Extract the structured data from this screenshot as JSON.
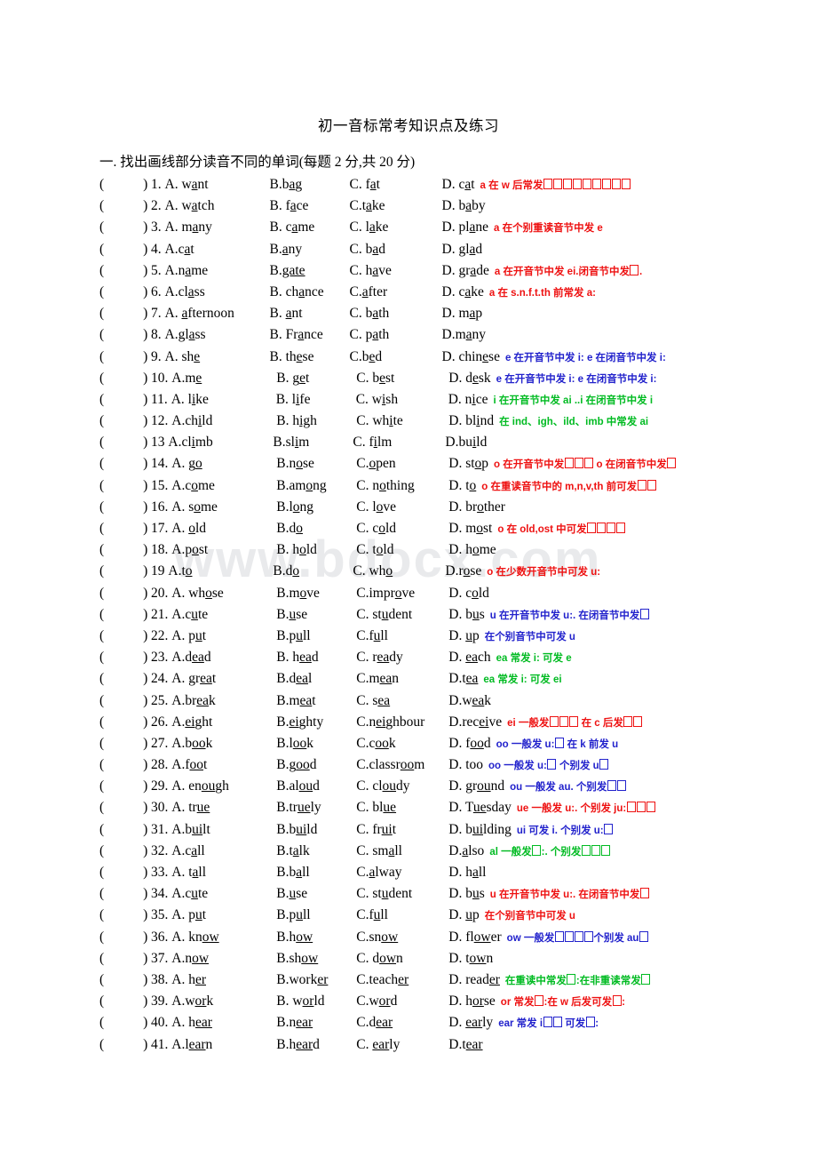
{
  "document": {
    "title": "初一音标常考知识点及练习",
    "watermark": "www.bdocx.com",
    "section_heading": "一. 找出画线部分读音不同的单词(每题 2 分,共 20 分)",
    "paren_open": "(",
    "paren_close": ")"
  },
  "colors": {
    "red": "#ee1111",
    "blue": "#2222cc",
    "green": "#00bb22",
    "text": "#000000",
    "watermark": "#e9eaec"
  },
  "questions": [
    {
      "num": "1.",
      "a": "A. w<u>a</u>nt",
      "b": "B.b<u>a</u>g",
      "c": "C. f<u>a</u>t",
      "d": "D. c<u>a</u>t",
      "note": "a 在 w 后常发▯▯▯▯▯▯▯▯▯",
      "note_color": "red"
    },
    {
      "num": "2.",
      "a": "A. w<u>a</u>tch",
      "b": "B. f<u>a</u>ce",
      "c": "C.t<u>a</u>ke",
      "d": "D. b<u>a</u>by",
      "note": "",
      "note_color": "red"
    },
    {
      "num": "3.",
      "a": "A. m<u>a</u>ny",
      "b": "B. c<u>a</u>me",
      "c": "C. l<u>a</u>ke",
      "d": "D. pl<u>a</u>ne",
      "note": "a 在个别重读音节中发 e",
      "note_color": "red"
    },
    {
      "num": "4.",
      "a": "A.c<u>a</u>t",
      "b": "B.<u>a</u>ny",
      "c": "C. b<u>a</u>d",
      "d": "D. gl<u>a</u>d",
      "note": "",
      "note_color": "red"
    },
    {
      "num": "5.",
      "a": "A.n<u>a</u>me",
      "b": "B.<u>gate</u>",
      "c": "C. h<u>a</u>ve",
      "d": "D. gr<u>a</u>de",
      "note": "a 在开音节中发 ei.闭音节中发▯.",
      "note_color": "red"
    },
    {
      "num": "6.",
      "a": "A.cl<u>a</u>ss",
      "b": "B. ch<u>a</u>nce",
      "c": "C.<u>a</u>fter",
      "d": "D. c<u>a</u>ke",
      "note": "a 在 s.n.f.t.th 前常发 a:",
      "note_color": "red"
    },
    {
      "num": "7.",
      "a": "A. <u>a</u>fternoon",
      "b": "B. <u>a</u>nt",
      "c": "C. b<u>a</u>th",
      "d": "D. m<u>a</u>p",
      "note": "",
      "note_color": "red"
    },
    {
      "num": "8.",
      "a": "A.gl<u>a</u>ss",
      "b": "B. Fr<u>a</u>nce",
      "c": "C. p<u>a</u>th",
      "d": "D.m<u>a</u>ny",
      "note": "",
      "note_color": "red"
    },
    {
      "num": "9.",
      "a": "A. sh<u>e</u>",
      "b": "B. th<u>e</u>se",
      "c": "C.b<u>e</u>d",
      "d": "D. chin<u>e</u>se",
      "note": "e 在开音节中发 i: e 在闭音节中发 i:",
      "note_color": "blue"
    },
    {
      "num": "10.",
      "a": "A.m<u>e</u>",
      "b": "B. g<u>e</u>t",
      "c": "C. b<u>e</u>st",
      "d": "D. d<u>e</u>sk",
      "note": "e 在开音节中发 i: e 在闭音节中发 i:",
      "note_color": "blue"
    },
    {
      "num": "11.",
      "a": "A. l<u>i</u>ke",
      "b": "B. l<u>i</u>fe",
      "c": "C. w<u>i</u>sh",
      "d": "D. n<u>i</u>ce",
      "note": "i 在开音节中发 ai ..i 在闭音节中发 i",
      "note_color": "green"
    },
    {
      "num": "12.",
      "a": "A.ch<u>i</u>ld",
      "b": "B. h<u>ig</u>h",
      "c": "C. wh<u>i</u>te",
      "d": "D. bl<u>i</u>nd",
      "note": "在 ind、igh、ild、imb 中常发 ai",
      "note_color": "green"
    },
    {
      "num": "13",
      "a": "A.cl<u>i</u>mb",
      "b": "B.sl<u>i</u>m",
      "c": "C. f<u>i</u>lm",
      "d": "D.bu<u>i</u>ld",
      "note": "",
      "note_color": "green"
    },
    {
      "num": "14.",
      "a": "A. g<u>o</u>",
      "b": "B.n<u>o</u>se",
      "c": "C.<u>o</u>pen",
      "d": "D. st<u>o</u>p",
      "note": "o 在开音节中发▯▯▯ o 在闭音节中发▯",
      "note_color": "red"
    },
    {
      "num": "15.",
      "a": "A.c<u>o</u>me",
      "b": "B.am<u>o</u>ng",
      "c": "C. n<u>o</u>thing",
      "d": "D. t<u>o</u>",
      "note": "o 在重读音节中的 m,n,v,th 前可发▯▯",
      "note_color": "red"
    },
    {
      "num": "16.",
      "a": "A. s<u>o</u>me",
      "b": "B.l<u>o</u>ng",
      "c": "C. l<u>o</u>ve",
      "d": "D. br<u>o</u>ther",
      "note": "",
      "note_color": "red"
    },
    {
      "num": "17.",
      "a": "A. <u>o</u>ld",
      "b": "B.d<u>o</u>",
      "c": "C. c<u>o</u>ld",
      "d": "D. m<u>o</u>st",
      "note": "o 在 old,ost 中可发▯▯▯▯",
      "note_color": "red"
    },
    {
      "num": "18.",
      "a": "A.p<u>o</u>st",
      "b": "B. h<u>o</u>ld",
      "c": "C. t<u>o</u>ld",
      "d": "D. h<u>o</u>me",
      "note": "",
      "note_color": "red"
    },
    {
      "num": "19",
      "a": "A.t<u>o</u>",
      "b": "B.d<u>o</u>",
      "c": "C. wh<u>o</u>",
      "d": "D.r<u>o</u>se",
      "note": "o 在少数开音节中可发 u:",
      "note_color": "red"
    },
    {
      "num": "20.",
      "a": "A. wh<u>o</u>se",
      "b": "B.m<u>o</u>ve",
      "c": "C.impr<u>o</u>ve",
      "d": "D. c<u>o</u>ld",
      "note": "",
      "note_color": "red"
    },
    {
      "num": "21.",
      "a": "A.c<u>u</u>te",
      "b": "B.<u>u</u>se",
      "c": "C. st<u>u</u>dent",
      "d": "D. b<u>u</u>s",
      "note": "u 在开音节中发 u:. 在闭音节中发▯",
      "note_color": "blue"
    },
    {
      "num": "22.",
      "a": "A. p<u>u</u>t",
      "b": "B.p<u>u</u>ll",
      "c": "C.f<u>u</u>ll",
      "d": "D. <u>u</u>p",
      "note": "在个别音节中可发 u",
      "note_color": "blue"
    },
    {
      "num": "23.",
      "a": "A.d<u>ea</u>d",
      "b": "B. h<u>ea</u>d",
      "c": "C. r<u>ea</u>dy",
      "d": "D. <u>ea</u>ch",
      "note": "ea 常发 i: 可发 e",
      "note_color": "green"
    },
    {
      "num": "24.",
      "a": "A. gr<u>ea</u>t",
      "b": "B.d<u>ea</u>l",
      "c": "C.m<u>ea</u>n",
      "d": "D.t<u>ea</u>",
      "note": "ea 常发 i: 可发 ei",
      "note_color": "green"
    },
    {
      "num": "25.",
      "a": "A.br<u>ea</u>k",
      "b": "B.m<u>ea</u>t",
      "c": "C. s<u>ea</u>",
      "d": "D.w<u>ea</u>k",
      "note": "",
      "note_color": "green"
    },
    {
      "num": "26.",
      "a": "A.<u>ei</u>ght",
      "b": "B.<u>ei</u>ghty",
      "c": "C.n<u>ei</u>ghbour",
      "d": "D.rec<u>ei</u>ve",
      "note": "ei 一般发▯▯▯ 在 c 后发▯▯",
      "note_color": "red"
    },
    {
      "num": "27.",
      "a": "A.b<u>oo</u>k",
      "b": "B.l<u>oo</u>k",
      "c": "C.c<u>oo</u>k",
      "d": "D. f<u>oo</u>d",
      "note": "oo 一般发 u:▯ 在 k 前发 u",
      "note_color": "blue"
    },
    {
      "num": "28.",
      "a": "A.f<u>oo</u>t",
      "b": "B.g<u>oo</u>d",
      "c": "C.classr<u>oo</u>m",
      "d": "D. too",
      "note": "oo 一般发 u:▯ 个别发 u▯",
      "note_color": "blue"
    },
    {
      "num": "29.",
      "a": "A. en<u>ou</u>gh",
      "b": "B.al<u>ou</u>d",
      "c": "C. cl<u>ou</u>dy",
      "d": "D. gr<u>ou</u>nd",
      "note": "ou 一般发 au. 个别发▯▯",
      "note_color": "blue"
    },
    {
      "num": "30.",
      "a": "A. tr<u>ue</u>",
      "b": "B.tr<u>ue</u>ly",
      "c": "C. bl<u>ue</u>",
      "d": "D. T<u>ue</u>sday",
      "note": "ue 一般发 u:. 个别发 ju:▯▯▯",
      "note_color": "red"
    },
    {
      "num": "31.",
      "a": "A.b<u>ui</u>lt",
      "b": "B.b<u>ui</u>ld",
      "c": "C. fr<u>ui</u>t",
      "d": "D. b<u>ui</u>lding",
      "note": "ui 可发 i. 个别发 u:▯",
      "note_color": "blue"
    },
    {
      "num": "32.",
      "a": "A.c<u>a</u>ll",
      "b": "B.t<u>a</u>lk",
      "c": "C. sm<u>a</u>ll",
      "d": "D.<u>a</u>lso",
      "note": "al 一般发▯:. 个别发▯▯▯",
      "note_color": "green"
    },
    {
      "num": "33.",
      "a": "A. t<u>a</u>ll",
      "b": "B.b<u>a</u>ll",
      "c": "C.<u>a</u>lway",
      "d": "D. h<u>a</u>ll",
      "note": "",
      "note_color": "green"
    },
    {
      "num": "34.",
      "a": "A.c<u>u</u>te",
      "b": "B.<u>u</u>se",
      "c": "C. st<u>u</u>dent",
      "d": "D. b<u>u</u>s",
      "note": "u 在开音节中发 u:. 在闭音节中发▯",
      "note_color": "red"
    },
    {
      "num": "35.",
      "a": "A. p<u>u</u>t",
      "b": "B.p<u>u</u>ll",
      "c": "C.f<u>u</u>ll",
      "d": "D. <u>u</u>p",
      "note": "在个别音节中可发 u",
      "note_color": "red"
    },
    {
      "num": "36.",
      "a": "A. kn<u>ow</u>",
      "b": "B.h<u>ow</u>",
      "c": "C.sn<u>ow</u>",
      "d": "D. fl<u>ow</u>er",
      "note": "ow 一般发▯▯▯▯个别发 au▯",
      "note_color": "blue"
    },
    {
      "num": "37.",
      "a": "A.n<u>ow</u>",
      "b": "B.sh<u>ow</u>",
      "c": "C. d<u>ow</u>n",
      "d": "D. t<u>ow</u>n",
      "note": "",
      "note_color": "blue"
    },
    {
      "num": "38.",
      "a": "A. h<u>er</u>",
      "b": "B.work<u>er</u>",
      "c": "C.teach<u>er</u>",
      "d": "D. read<u>er</u>",
      "note": "在重读中常发▯:在非重读常发▯",
      "note_color": "green"
    },
    {
      "num": "39.",
      "a": "A.w<u>or</u>k",
      "b": "B. w<u>or</u>ld",
      "c": "C.w<u>or</u>d",
      "d": "D. h<u>or</u>se",
      "note": "or 常发▯:在 w 后发可发▯:",
      "note_color": "red"
    },
    {
      "num": "40.",
      "a": "A. h<u>ear</u>",
      "b": "B.n<u>ear</u>",
      "c": "C.d<u>ear</u>",
      "d": "D. <u>ear</u>ly",
      "note": "ear 常发 i▯▯ 可发▯:",
      "note_color": "blue"
    },
    {
      "num": "41.",
      "a": "A.l<u>ear</u>n",
      "b": "B.h<u>ear</u>d",
      "c": "C. <u>ear</u>ly",
      "d": "D.t<u>ear</u>",
      "note": "",
      "note_color": "blue"
    }
  ]
}
